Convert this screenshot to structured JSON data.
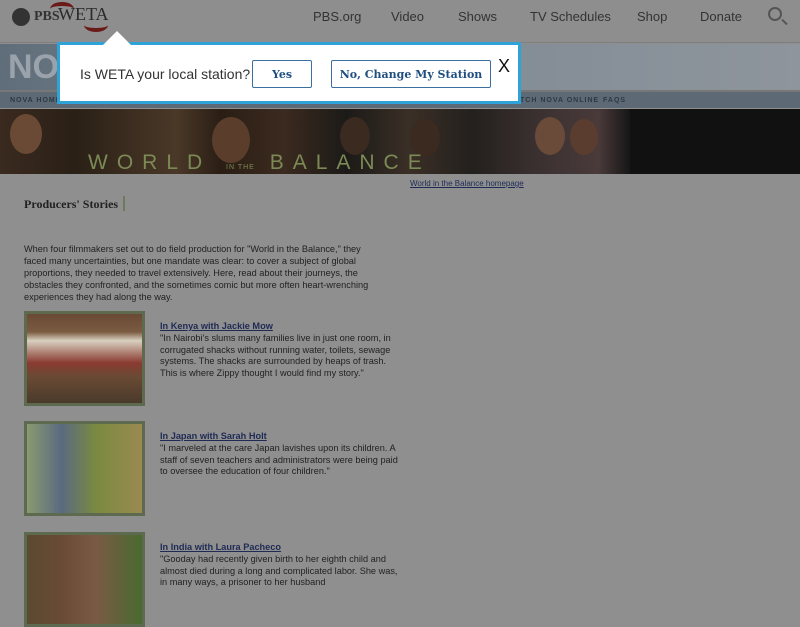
{
  "header": {
    "pbs": "PBS",
    "station": "WETA",
    "nav": [
      "PBS.org",
      "Video",
      "Shows",
      "TV Schedules",
      "Shop",
      "Donate"
    ]
  },
  "nova": {
    "logo": "NOVA",
    "nav": [
      "NOVA HOME",
      "TCH NOVA ONLINE",
      "FAQS"
    ]
  },
  "banner": {
    "title_a": "WORLD",
    "title_small": "IN THE",
    "title_b": "BALANCE"
  },
  "page": {
    "home_link": "World in the Balance homepage",
    "heading": "Producers' Stories",
    "intro": "When four filmmakers set out to do field production for \"World in the Balance,\" they faced many uncertainties, but one mandate was clear: to cover a subject of global proportions, they needed to travel extensively. Here, read about their journeys, the obstacles they confronted, and the sometimes comic but more often heart-wrenching experiences they had along the way.",
    "stories": [
      {
        "title": "In Kenya with Jackie Mow",
        "text": "\"In Nairobi's slums many families live in just one room, in corrugated shacks without running water, toilets, sewage systems. The shacks are surrounded by heaps of trash. This is where Zippy thought I would find my story.\""
      },
      {
        "title": "In Japan with Sarah Holt",
        "text": "\"I marveled at the care Japan lavishes upon its children. A staff of seven teachers and administrators were being paid to oversee the education of four children.\""
      },
      {
        "title": "In India with Laura Pacheco",
        "text": "\"Gooday had recently given birth to her eighth child and almost died during a long and complicated labor. She was, in many ways, a prisoner to her husband"
      }
    ]
  },
  "modal": {
    "question": "Is WETA your local station?",
    "yes": "Yes",
    "no": "No, Change My Station",
    "close": "X"
  }
}
